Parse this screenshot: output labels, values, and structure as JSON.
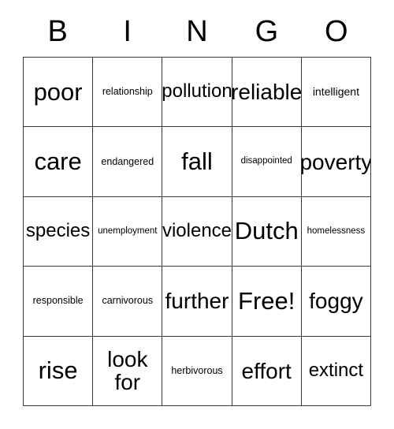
{
  "card": {
    "header_letters": [
      "B",
      "I",
      "N",
      "G",
      "O"
    ],
    "free_space_label": "Free!",
    "grid": {
      "rows": 5,
      "columns": 5,
      "cells": [
        [
          {
            "text": "poor",
            "size": "xl"
          },
          {
            "text": "relationship",
            "size": "xxs"
          },
          {
            "text": "pollution",
            "size": "md"
          },
          {
            "text": "reliable",
            "size": "lg"
          },
          {
            "text": "intelligent",
            "size": "xs"
          }
        ],
        [
          {
            "text": "care",
            "size": "xl"
          },
          {
            "text": "endangered",
            "size": "xxs"
          },
          {
            "text": "fall",
            "size": "xl"
          },
          {
            "text": "disappointed",
            "size": "tiny"
          },
          {
            "text": "poverty",
            "size": "lg"
          }
        ],
        [
          {
            "text": "species",
            "size": "md"
          },
          {
            "text": "unemployment",
            "size": "tiny"
          },
          {
            "text": "violence",
            "size": "md"
          },
          {
            "text": "Dutch",
            "size": "xl"
          },
          {
            "text": "homelessness",
            "size": "tiny"
          }
        ],
        [
          {
            "text": "responsible",
            "size": "xxs"
          },
          {
            "text": "carnivorous",
            "size": "xxs"
          },
          {
            "text": "further",
            "size": "lg"
          },
          {
            "text": "Free!",
            "size": "xl"
          },
          {
            "text": "foggy",
            "size": "lg"
          }
        ],
        [
          {
            "text": "rise",
            "size": "xl"
          },
          {
            "text": "look for",
            "size": "lg"
          },
          {
            "text": "herbivorous",
            "size": "xxs"
          },
          {
            "text": "effort",
            "size": "lg"
          },
          {
            "text": "extinct",
            "size": "md"
          }
        ]
      ]
    },
    "colors": {
      "background": "#ffffff",
      "text": "#000000",
      "grid_line": "#3a3a3a"
    }
  }
}
